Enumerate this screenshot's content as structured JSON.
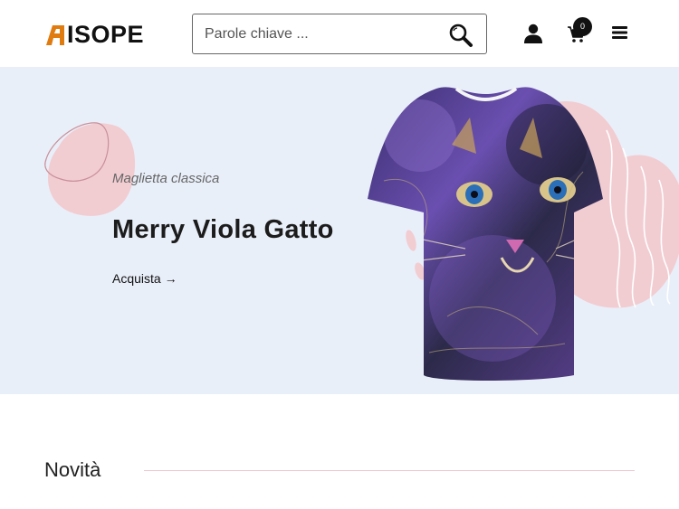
{
  "brand": {
    "name": "ISOPE",
    "accent": "#e07b10"
  },
  "search": {
    "placeholder": "Parole chiave ..."
  },
  "header": {
    "icons": [
      "search-icon",
      "user-icon",
      "cart-icon",
      "menu-icon"
    ],
    "cart_count": "0"
  },
  "hero": {
    "subtitle": "Maglietta classica",
    "title": "Merry Viola Gatto",
    "cta": "Acquista →",
    "background": "#e9eff9",
    "decor_color": "#f1cdd2"
  },
  "section": {
    "title": "Novità"
  }
}
